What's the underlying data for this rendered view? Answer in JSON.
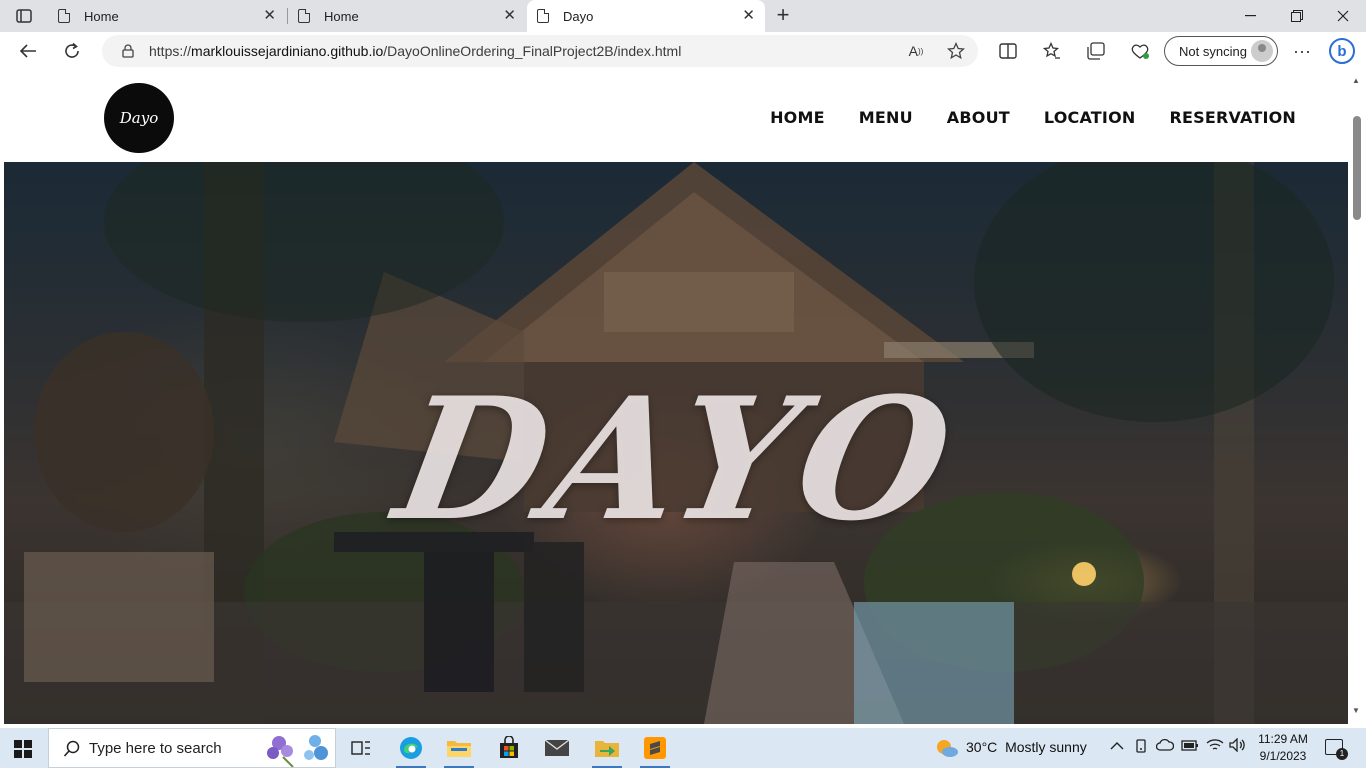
{
  "browser": {
    "tabs": [
      {
        "title": "Home",
        "active": false
      },
      {
        "title": "Home",
        "active": false
      },
      {
        "title": "Dayo",
        "active": true
      }
    ],
    "url_prefix": "https://",
    "url_host": "marklouissejardiniano.github.io",
    "url_path": "/DayoOnlineOrdering_FinalProject2B/index.html",
    "sync_label": "Not syncing"
  },
  "site": {
    "logo_text": "Dayo",
    "nav": [
      "HOME",
      "MENU",
      "ABOUT",
      "LOCATION",
      "RESERVATION"
    ],
    "hero_title": "DAYO"
  },
  "taskbar": {
    "search_placeholder": "Type here to search",
    "weather_temp": "30°C",
    "weather_desc": "Mostly sunny",
    "time": "11:29 AM",
    "date": "9/1/2023",
    "notification_count": "1"
  },
  "colors": {
    "tabstrip": "#dfe1e5",
    "taskbar": "#dbe8f3",
    "accent": "#3b78c4"
  }
}
